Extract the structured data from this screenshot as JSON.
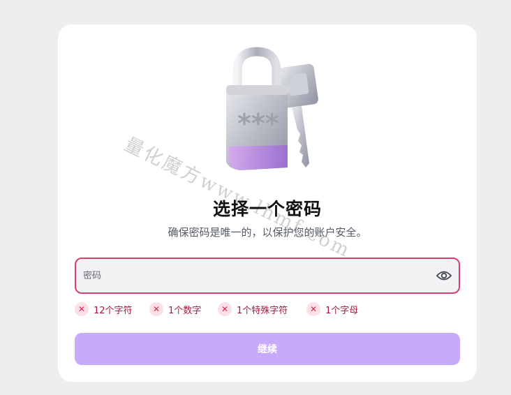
{
  "header": {
    "title": "选择一个密码",
    "subtitle": "确保密码是唯一的，以保护您的账户安全。"
  },
  "password_field": {
    "placeholder": "密码",
    "value": "",
    "toggle_icon": "eye-icon"
  },
  "requirements": [
    {
      "label": "12个字符",
      "status": "unmet",
      "icon": "close-icon"
    },
    {
      "label": "1个数字",
      "status": "unmet",
      "icon": "close-icon"
    },
    {
      "label": "1个特殊字符",
      "status": "unmet",
      "icon": "close-icon"
    },
    {
      "label": "1个字母",
      "status": "unmet",
      "icon": "close-icon"
    }
  ],
  "continue_button": {
    "label": "继续",
    "enabled": false
  },
  "illustration": {
    "icon": "padlock-with-key-icon",
    "lock_text": "***"
  },
  "watermark": {
    "text": "量化魔方www.lhmf.com"
  },
  "colors": {
    "error": "#d93f6a",
    "button_disabled": "#c8aafc",
    "error_badge_bg": "#fde0e6",
    "error_text": "#a8163b"
  }
}
